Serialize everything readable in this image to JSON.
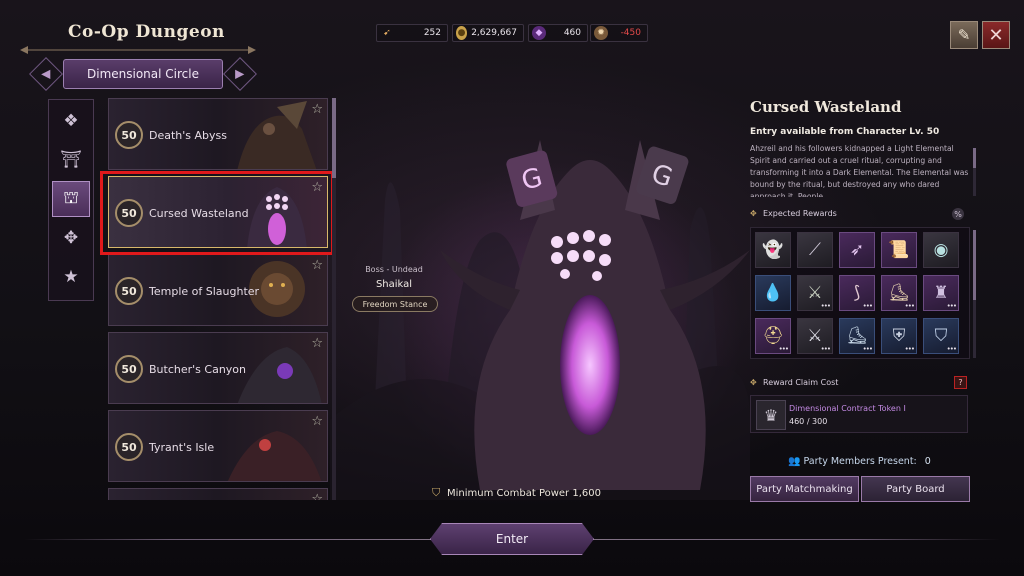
{
  "header": {
    "title": "Co-Op Dungeon",
    "subtab": "Dimensional Circle",
    "subtab_prev_icon": "chevron-left-icon",
    "subtab_next_icon": "chevron-right-icon"
  },
  "currencies": [
    {
      "icon": "arrow-icon",
      "value": "252"
    },
    {
      "icon": "gold-coin-icon",
      "value": "2,629,667"
    },
    {
      "icon": "purple-crystal-icon",
      "value": "460"
    },
    {
      "icon": "gear-token-icon",
      "value": "-450"
    }
  ],
  "top_buttons": {
    "help": "guide-icon",
    "close": "close-icon"
  },
  "categories": [
    {
      "icon": "diamond-grid-icon"
    },
    {
      "icon": "gate-icon"
    },
    {
      "icon": "dimensional-gate-icon",
      "active": true
    },
    {
      "icon": "crest-icon"
    },
    {
      "icon": "star-icon"
    }
  ],
  "dungeons": [
    {
      "level": "50",
      "name": "Death's Abyss"
    },
    {
      "level": "50",
      "name": "Cursed Wasteland",
      "selected": true
    },
    {
      "level": "50",
      "name": "Temple of Slaughter"
    },
    {
      "level": "50",
      "name": "Butcher's Canyon"
    },
    {
      "level": "50",
      "name": "Tyrant's Isle"
    }
  ],
  "boss": {
    "type": "Boss - Undead",
    "name": "Shaikal",
    "stance": "Freedom Stance"
  },
  "min_power": "Minimum Combat Power 1,600",
  "enter_label": "Enter",
  "detail": {
    "title": "Cursed Wasteland",
    "entry": "Entry available from Character Lv. 50",
    "description": "Ahzreil and his followers kidnapped a Light Elemental Spirit and carried out a cruel ritual, corrupting and transforming it into a Dark Elemental. The Elemental was bound by the ritual, but destroyed any who dared approach it. People",
    "rewards_label": "Expected Rewards",
    "rewards": [
      {
        "icon": "ghost-spirit-icon",
        "rarity": "dark",
        "more": false
      },
      {
        "icon": "spear-icon",
        "rarity": "dark",
        "more": false
      },
      {
        "icon": "bow-icon",
        "rarity": "purple",
        "more": false
      },
      {
        "icon": "scroll-icon",
        "rarity": "purple",
        "more": false
      },
      {
        "icon": "orb-icon",
        "rarity": "dark",
        "more": false
      },
      {
        "icon": "water-drop-icon",
        "rarity": "blue",
        "more": false
      },
      {
        "icon": "crossbow-icon",
        "rarity": "dark",
        "more": true
      },
      {
        "icon": "longbow-icon",
        "rarity": "purple",
        "more": true
      },
      {
        "icon": "boots-icon",
        "rarity": "purple",
        "more": true
      },
      {
        "icon": "armor-icon",
        "rarity": "purple",
        "more": true
      },
      {
        "icon": "helmet-icon",
        "rarity": "purple",
        "more": true
      },
      {
        "icon": "crossed-blades-icon",
        "rarity": "dark",
        "more": true
      },
      {
        "icon": "greaves-icon",
        "rarity": "blue",
        "more": true
      },
      {
        "icon": "chestplate-icon",
        "rarity": "blue",
        "more": true
      },
      {
        "icon": "cloak-icon",
        "rarity": "blue",
        "more": true
      }
    ],
    "claim_label": "Reward Claim Cost",
    "token_name": "Dimensional Contract Token I",
    "token_count": "460 / 300",
    "party_label": "Party Members Present:",
    "party_count": "0",
    "matchmaking_label": "Party Matchmaking",
    "board_label": "Party Board"
  },
  "colors": {
    "accent": "#5a3d6a",
    "gold_border": "#d8b86a",
    "negative": "#e24a4a",
    "highlight_outline": "#e0191b"
  }
}
